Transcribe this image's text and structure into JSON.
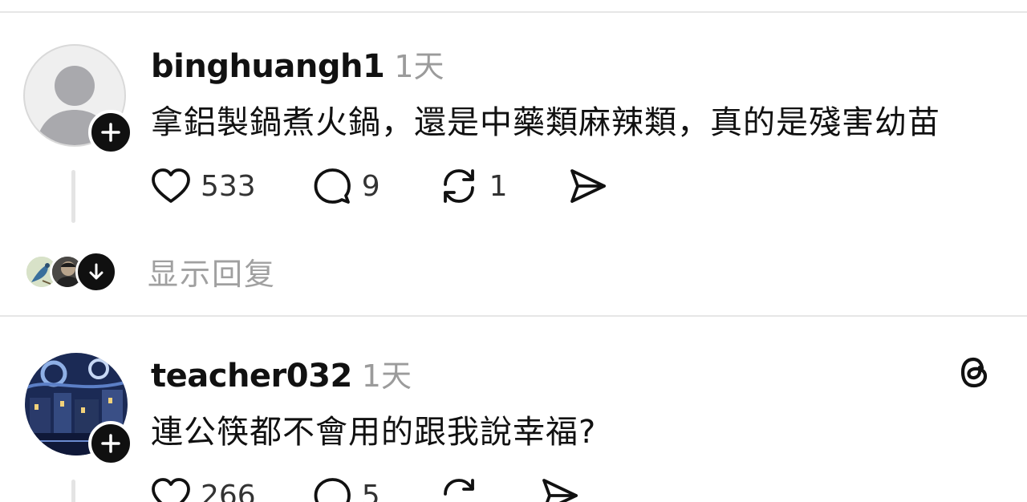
{
  "posts": [
    {
      "username": "binghuangh1",
      "time": "1天",
      "text": "拿鋁製鍋煮火鍋，還是中藥類麻辣類，真的是殘害幼苗",
      "likes": "533",
      "comments": "9",
      "reposts": "1",
      "show_replies": "显示回复"
    },
    {
      "username": "teacher032",
      "time": "1天",
      "text": "連公筷都不會用的跟我說幸福?",
      "likes": "266",
      "comments": "5"
    }
  ],
  "colors": {
    "text": "#111111",
    "muted": "#9b9b9b",
    "divider": "#e6e6e6",
    "follow_badge": "#101010"
  },
  "icons": [
    "plus-icon",
    "heart-icon",
    "comment-icon",
    "repost-icon",
    "share-icon",
    "arrow-down-icon",
    "threads-logo-icon"
  ]
}
